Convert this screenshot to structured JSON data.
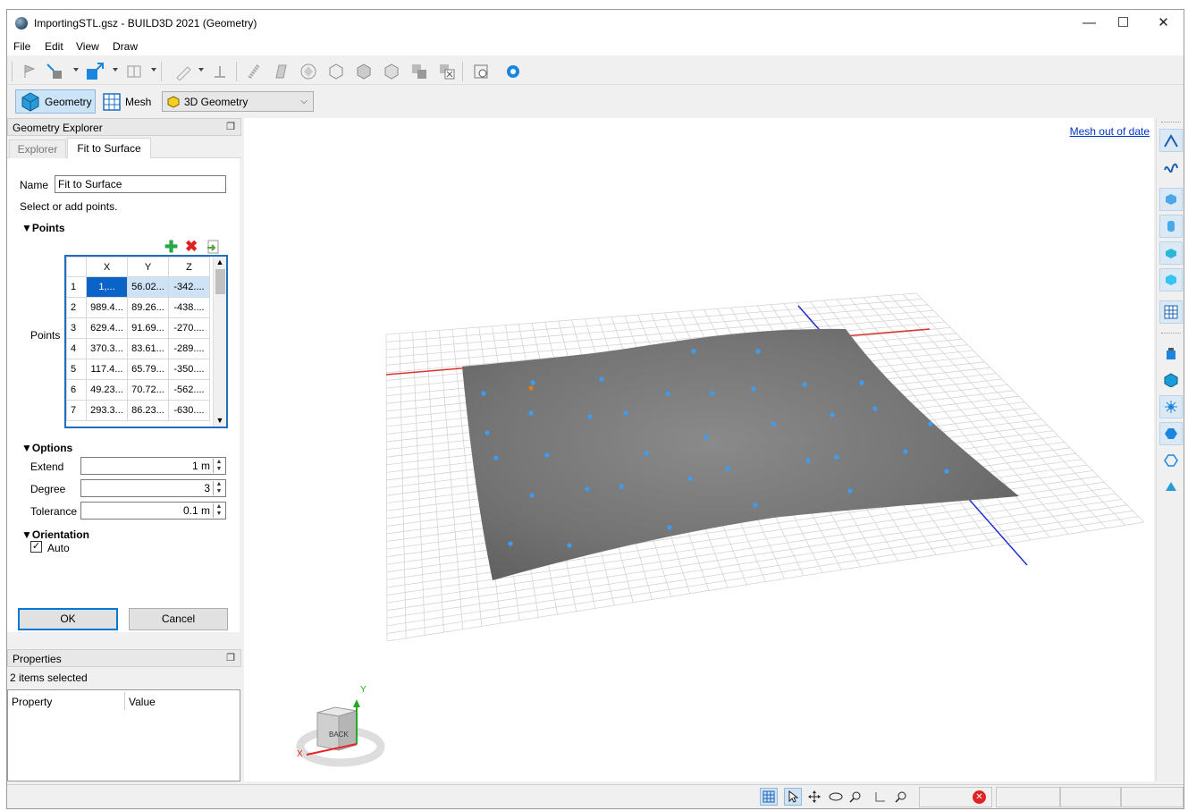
{
  "window": {
    "title": "ImportingSTL.gsz - BUILD3D 2021 (Geometry)",
    "min": "—",
    "max": "☐",
    "close": "✕"
  },
  "menu": [
    "File",
    "Edit",
    "View",
    "Draw"
  ],
  "toolbar2": {
    "geometry": "Geometry",
    "mesh": "Mesh",
    "mode_value": "3D Geometry"
  },
  "explorer": {
    "header": "Geometry Explorer",
    "tabs": [
      "Explorer",
      "Fit to Surface"
    ],
    "name_label": "Name",
    "name_value": "Fit to Surface",
    "hint": "Select or add points.",
    "points_section": "Points",
    "points_label": "Points",
    "columns": [
      "X",
      "Y",
      "Z"
    ],
    "rows": [
      [
        "1",
        "1,...",
        "56.02...",
        "-342...."
      ],
      [
        "2",
        "989.4...",
        "89.26...",
        "-438...."
      ],
      [
        "3",
        "629.4...",
        "91.69...",
        "-270...."
      ],
      [
        "4",
        "370.3...",
        "83.61...",
        "-289...."
      ],
      [
        "5",
        "117.4...",
        "65.79...",
        "-350...."
      ],
      [
        "6",
        "49.23...",
        "70.72...",
        "-562...."
      ],
      [
        "7",
        "293.3...",
        "86.23...",
        "-630...."
      ]
    ],
    "options_section": "Options",
    "extend_label": "Extend",
    "extend_value": "1 m",
    "degree_label": "Degree",
    "degree_value": "3",
    "tolerance_label": "Tolerance",
    "tolerance_value": "0.1 m",
    "orientation_section": "Orientation",
    "auto_label": "Auto",
    "ok": "OK",
    "cancel": "Cancel"
  },
  "properties": {
    "header": "Properties",
    "selected": "2 items selected",
    "col_property": "Property",
    "col_value": "Value"
  },
  "viewport": {
    "mesh_status": "Mesh out of date",
    "cube_face": "BACK",
    "axis_x": "X",
    "axis_y": "Y"
  },
  "colors": {
    "accent": "#0078d7",
    "surface": "#7a7a7a",
    "point": "#3d9cf5",
    "x_axis": "#e03030",
    "z_axis": "#2030d0"
  }
}
